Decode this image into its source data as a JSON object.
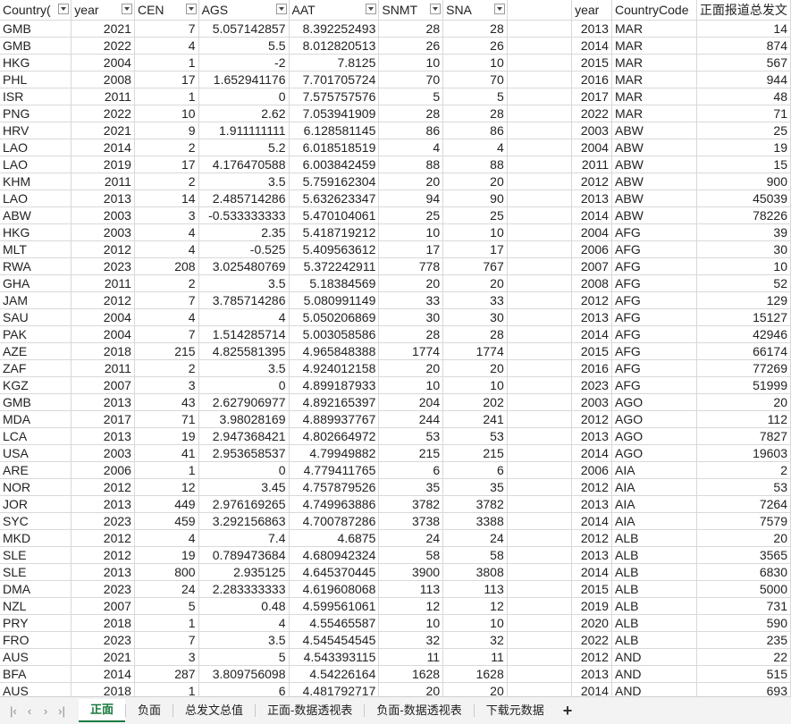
{
  "left_headers": [
    "Country(",
    "year",
    "CEN",
    "AGS",
    "AAT",
    "SNMT",
    "SNA"
  ],
  "right_headers": [
    "year",
    "CountryCode",
    "正面报道总发文"
  ],
  "left_rows": [
    [
      "GMB",
      "2021",
      "7",
      "5.057142857",
      "8.392252493",
      "28",
      "28"
    ],
    [
      "GMB",
      "2022",
      "4",
      "5.5",
      "8.012820513",
      "26",
      "26"
    ],
    [
      "HKG",
      "2004",
      "1",
      "-2",
      "7.8125",
      "10",
      "10"
    ],
    [
      "PHL",
      "2008",
      "17",
      "1.652941176",
      "7.701705724",
      "70",
      "70"
    ],
    [
      "ISR",
      "2011",
      "1",
      "0",
      "7.575757576",
      "5",
      "5"
    ],
    [
      "PNG",
      "2022",
      "10",
      "2.62",
      "7.053941909",
      "28",
      "28"
    ],
    [
      "HRV",
      "2021",
      "9",
      "1.911111111",
      "6.128581145",
      "86",
      "86"
    ],
    [
      "LAO",
      "2014",
      "2",
      "5.2",
      "6.018518519",
      "4",
      "4"
    ],
    [
      "LAO",
      "2019",
      "17",
      "4.176470588",
      "6.003842459",
      "88",
      "88"
    ],
    [
      "KHM",
      "2011",
      "2",
      "3.5",
      "5.759162304",
      "20",
      "20"
    ],
    [
      "LAO",
      "2013",
      "14",
      "2.485714286",
      "5.632623347",
      "94",
      "90"
    ],
    [
      "ABW",
      "2003",
      "3",
      "-0.533333333",
      "5.470104061",
      "25",
      "25"
    ],
    [
      "HKG",
      "2003",
      "4",
      "2.35",
      "5.418719212",
      "10",
      "10"
    ],
    [
      "MLT",
      "2012",
      "4",
      "-0.525",
      "5.409563612",
      "17",
      "17"
    ],
    [
      "RWA",
      "2023",
      "208",
      "3.025480769",
      "5.372242911",
      "778",
      "767"
    ],
    [
      "GHA",
      "2011",
      "2",
      "3.5",
      "5.18384569",
      "20",
      "20"
    ],
    [
      "JAM",
      "2012",
      "7",
      "3.785714286",
      "5.080991149",
      "33",
      "33"
    ],
    [
      "SAU",
      "2004",
      "4",
      "4",
      "5.050206869",
      "30",
      "30"
    ],
    [
      "PAK",
      "2004",
      "7",
      "1.514285714",
      "5.003058586",
      "28",
      "28"
    ],
    [
      "AZE",
      "2018",
      "215",
      "4.825581395",
      "4.965848388",
      "1774",
      "1774"
    ],
    [
      "ZAF",
      "2011",
      "2",
      "3.5",
      "4.924012158",
      "20",
      "20"
    ],
    [
      "KGZ",
      "2007",
      "3",
      "0",
      "4.899187933",
      "10",
      "10"
    ],
    [
      "GMB",
      "2013",
      "43",
      "2.627906977",
      "4.892165397",
      "204",
      "202"
    ],
    [
      "MDA",
      "2017",
      "71",
      "3.98028169",
      "4.889937767",
      "244",
      "241"
    ],
    [
      "LCA",
      "2013",
      "19",
      "2.947368421",
      "4.802664972",
      "53",
      "53"
    ],
    [
      "USA",
      "2003",
      "41",
      "2.953658537",
      "4.79949882",
      "215",
      "215"
    ],
    [
      "ARE",
      "2006",
      "1",
      "0",
      "4.779411765",
      "6",
      "6"
    ],
    [
      "NOR",
      "2012",
      "12",
      "3.45",
      "4.757879526",
      "35",
      "35"
    ],
    [
      "JOR",
      "2013",
      "449",
      "2.976169265",
      "4.749963886",
      "3782",
      "3782"
    ],
    [
      "SYC",
      "2023",
      "459",
      "3.292156863",
      "4.700787286",
      "3738",
      "3388"
    ],
    [
      "MKD",
      "2012",
      "4",
      "7.4",
      "4.6875",
      "24",
      "24"
    ],
    [
      "SLE",
      "2012",
      "19",
      "0.789473684",
      "4.680942324",
      "58",
      "58"
    ],
    [
      "SLE",
      "2013",
      "800",
      "2.935125",
      "4.645370445",
      "3900",
      "3808"
    ],
    [
      "DMA",
      "2023",
      "24",
      "2.283333333",
      "4.619608068",
      "113",
      "113"
    ],
    [
      "NZL",
      "2007",
      "5",
      "0.48",
      "4.599561061",
      "12",
      "12"
    ],
    [
      "PRY",
      "2018",
      "1",
      "4",
      "4.55465587",
      "10",
      "10"
    ],
    [
      "FRO",
      "2023",
      "7",
      "3.5",
      "4.545454545",
      "32",
      "32"
    ],
    [
      "AUS",
      "2021",
      "3",
      "5",
      "4.543393115",
      "11",
      "11"
    ],
    [
      "BFA",
      "2014",
      "287",
      "3.809756098",
      "4.54226164",
      "1628",
      "1628"
    ],
    [
      "AUS",
      "2018",
      "1",
      "6",
      "4.481792717",
      "20",
      "20"
    ]
  ],
  "right_rows": [
    [
      "2013",
      "MAR",
      "14"
    ],
    [
      "2014",
      "MAR",
      "874"
    ],
    [
      "2015",
      "MAR",
      "567"
    ],
    [
      "2016",
      "MAR",
      "944"
    ],
    [
      "2017",
      "MAR",
      "48"
    ],
    [
      "2022",
      "MAR",
      "71"
    ],
    [
      "2003",
      "ABW",
      "25"
    ],
    [
      "2004",
      "ABW",
      "19"
    ],
    [
      "2011",
      "ABW",
      "15"
    ],
    [
      "2012",
      "ABW",
      "900"
    ],
    [
      "2013",
      "ABW",
      "45039"
    ],
    [
      "2014",
      "ABW",
      "78226"
    ],
    [
      "2004",
      "AFG",
      "39"
    ],
    [
      "2006",
      "AFG",
      "30"
    ],
    [
      "2007",
      "AFG",
      "10"
    ],
    [
      "2008",
      "AFG",
      "52"
    ],
    [
      "2012",
      "AFG",
      "129"
    ],
    [
      "2013",
      "AFG",
      "15127"
    ],
    [
      "2014",
      "AFG",
      "42946"
    ],
    [
      "2015",
      "AFG",
      "66174"
    ],
    [
      "2016",
      "AFG",
      "77269"
    ],
    [
      "2023",
      "AFG",
      "51999"
    ],
    [
      "2003",
      "AGO",
      "20"
    ],
    [
      "2012",
      "AGO",
      "112"
    ],
    [
      "2013",
      "AGO",
      "7827"
    ],
    [
      "2014",
      "AGO",
      "19603"
    ],
    [
      "2006",
      "AIA",
      "2"
    ],
    [
      "2012",
      "AIA",
      "53"
    ],
    [
      "2013",
      "AIA",
      "7264"
    ],
    [
      "2014",
      "AIA",
      "7579"
    ],
    [
      "2012",
      "ALB",
      "20"
    ],
    [
      "2013",
      "ALB",
      "3565"
    ],
    [
      "2014",
      "ALB",
      "6830"
    ],
    [
      "2015",
      "ALB",
      "5000"
    ],
    [
      "2019",
      "ALB",
      "731"
    ],
    [
      "2020",
      "ALB",
      "590"
    ],
    [
      "2022",
      "ALB",
      "235"
    ],
    [
      "2012",
      "AND",
      "22"
    ],
    [
      "2013",
      "AND",
      "515"
    ],
    [
      "2014",
      "AND",
      "693"
    ]
  ],
  "tabs": [
    "正面",
    "负面",
    "总发文总值",
    "正面-数据透视表",
    "负面-数据透视表",
    "下载元数据"
  ],
  "active_tab": 0,
  "nav": {
    "prev": "‹",
    "next": "›",
    "last": "›|",
    "first": "|‹"
  },
  "add_label": "+",
  "colors": {
    "active_tab": "#1a7a40",
    "grid": "#d9d9d9"
  }
}
